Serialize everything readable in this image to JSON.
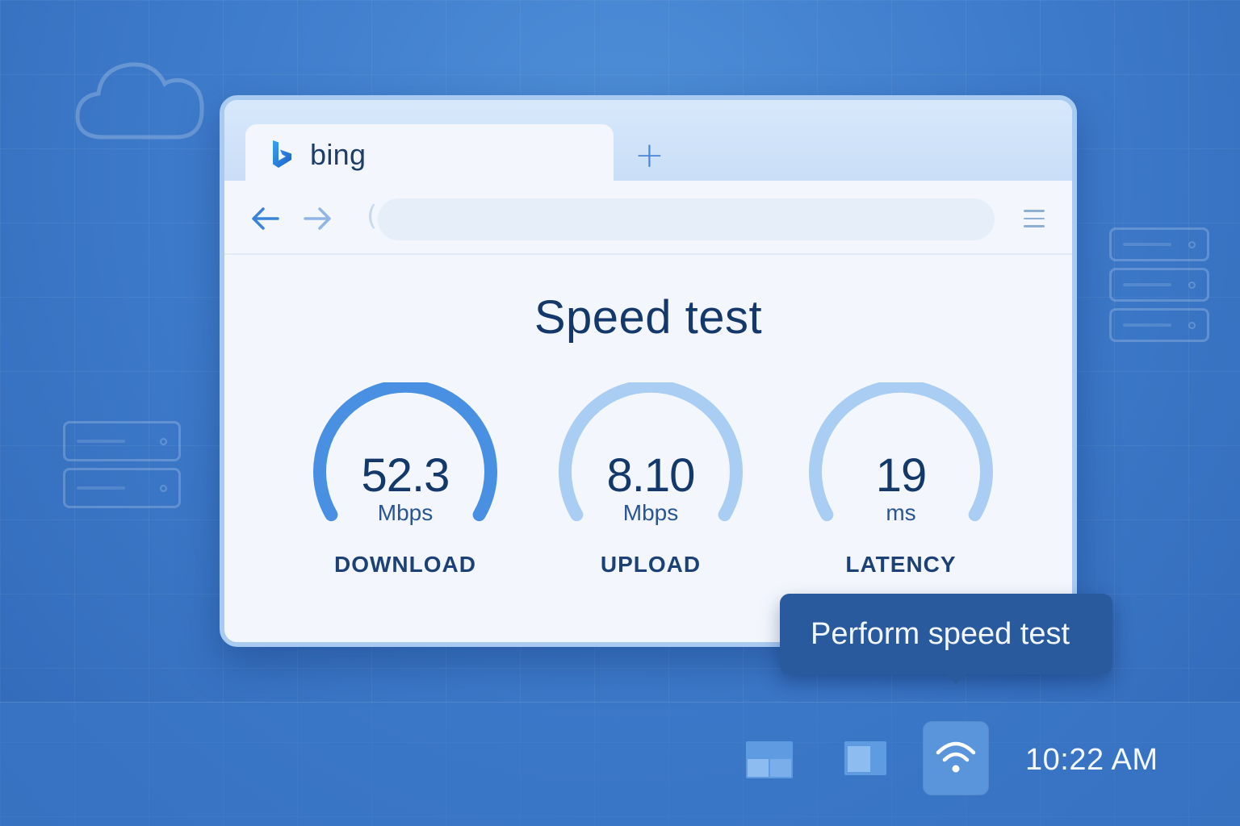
{
  "browser": {
    "tab_title": "bing",
    "new_tab_label": "+",
    "address_value": "",
    "page_title": "Speed test"
  },
  "gauges": [
    {
      "value": "52.3",
      "unit": "Mbps",
      "label": "DOWNLOAD",
      "accent": "#4a90e2"
    },
    {
      "value": "8.10",
      "unit": "Mbps",
      "label": "UPLOAD",
      "accent": "#a9cdf3"
    },
    {
      "value": "19",
      "unit": "ms",
      "label": "LATENCY",
      "accent": "#a9cdf3"
    }
  ],
  "tooltip": {
    "text": "Perform speed test"
  },
  "taskbar": {
    "clock": "10:22 AM"
  },
  "colors": {
    "background": "#3f7ccc",
    "title": "#15386a",
    "tooltip_bg": "#2a5a9e"
  },
  "icons": [
    "bing-logo-icon",
    "back-arrow-icon",
    "forward-arrow-icon",
    "menu-icon",
    "widgets-icon",
    "window-icon",
    "wifi-icon",
    "cloud-icon",
    "server-icon"
  ]
}
